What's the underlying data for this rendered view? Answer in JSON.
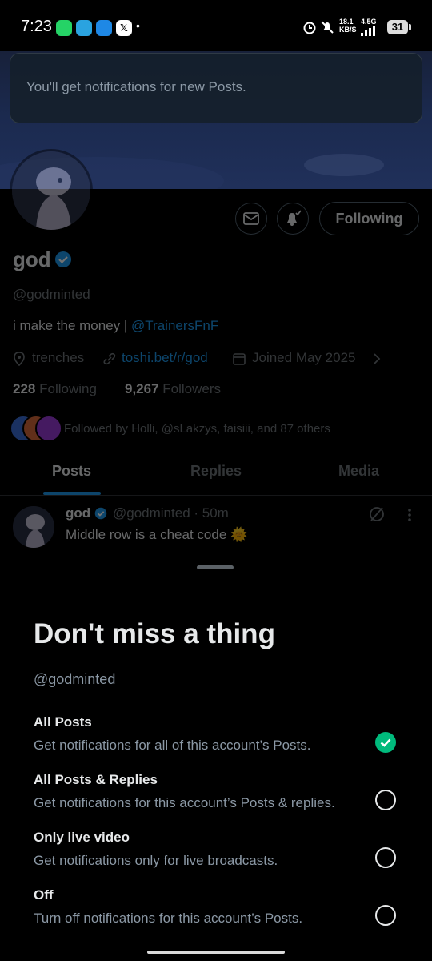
{
  "status_bar": {
    "time": "7:23",
    "net_speed": "18.1 KB/S",
    "network": "4.5G",
    "battery": "31",
    "dot": "•"
  },
  "toast": {
    "message": "You'll get notifications for new Posts."
  },
  "profile": {
    "name": "god",
    "handle": "@godminted",
    "bio_text": "i make the money | ",
    "bio_link": "@TrainersFnF",
    "location": "trenches",
    "website": "toshi.bet/r/god",
    "joined": "Joined May 2025",
    "following_count": "228",
    "following_label": "Following",
    "followers_count": "9,267",
    "followers_label": "Followers",
    "followed_by": "Followed by Holli, @sLakzys, faisiii, and 87 others",
    "follow_button": "Following",
    "accent_color": "#1d9bf0"
  },
  "tabs": [
    {
      "label": "Posts",
      "active": true
    },
    {
      "label": "Replies",
      "active": false
    },
    {
      "label": "Media",
      "active": false
    }
  ],
  "post": {
    "author": "god",
    "meta": "@godminted · 50m",
    "text": "Middle row is a cheat code 🌞"
  },
  "sheet": {
    "title": "Don't miss a thing",
    "handle": "@godminted",
    "options": [
      {
        "title": "All Posts",
        "desc": "Get notifications for all of this account’s Posts.",
        "selected": true
      },
      {
        "title": "All Posts & Replies",
        "desc": "Get notifications for this account’s Posts & replies.",
        "selected": false
      },
      {
        "title": "Only live video",
        "desc": "Get notifications only for live broadcasts.",
        "selected": false
      },
      {
        "title": "Off",
        "desc": "Turn off notifications for this account’s Posts.",
        "selected": false
      }
    ],
    "selected_color": "#00ba7c"
  }
}
